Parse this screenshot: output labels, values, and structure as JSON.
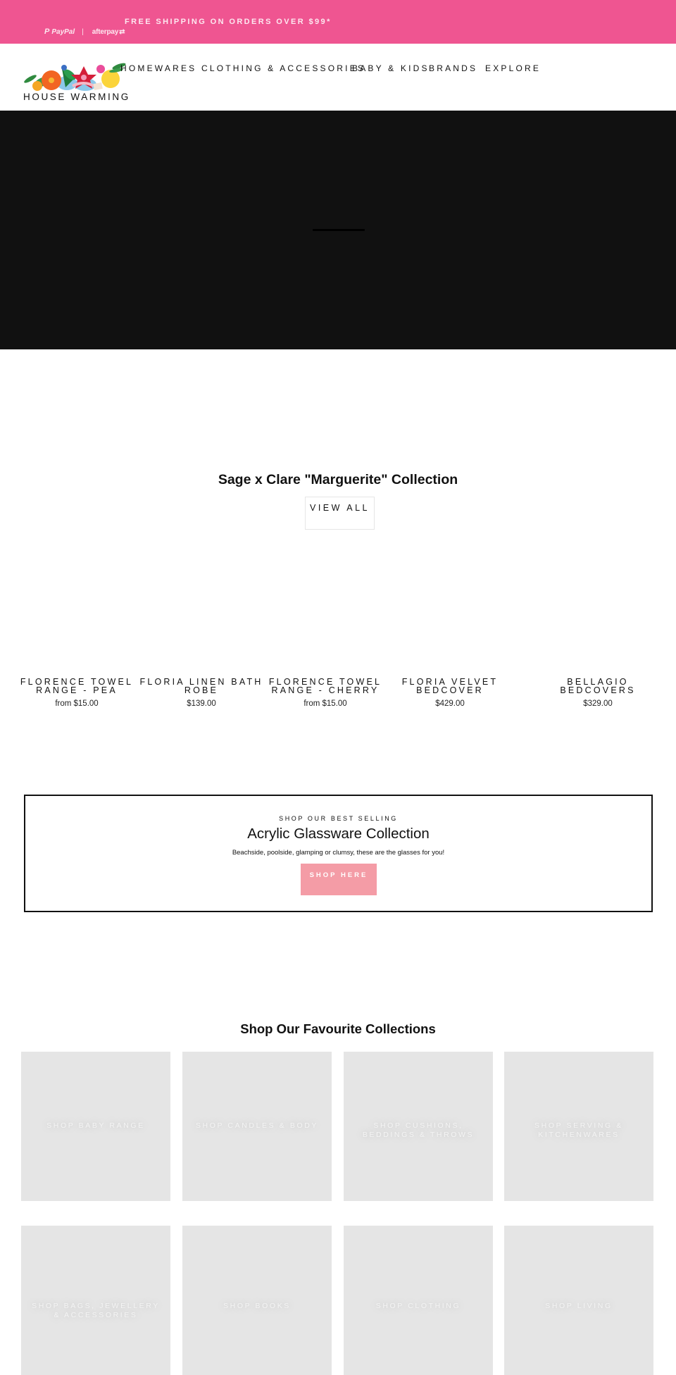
{
  "announcement": {
    "text": "FREE SHIPPING ON ORDERS OVER $99*",
    "payments": {
      "paypal_label": "PayPal",
      "separator": "|",
      "afterpay_label": "afterpay"
    }
  },
  "header": {
    "logo_text": "HOUSE WARMING",
    "nav": [
      {
        "label": "HOMEWARES"
      },
      {
        "label": "CLOTHING & ACCESSORIES"
      },
      {
        "label": "BABY & KIDS"
      },
      {
        "label": "BRANDS"
      },
      {
        "label": "EXPLORE"
      }
    ]
  },
  "featured": {
    "title": "Sage x Clare \"Marguerite\" Collection",
    "view_all_label": "VIEW ALL",
    "products": [
      {
        "name": "Florence Towel Range - Pea",
        "price": "from $15.00"
      },
      {
        "name": "Floria Linen Bath Robe",
        "price": "$139.00"
      },
      {
        "name": "Florence Towel Range - Cherry",
        "price": "from $15.00"
      },
      {
        "name": "Floria Velvet Bedcover",
        "price": "$429.00"
      },
      {
        "name": "Bellagio Bedcovers",
        "price": "$329.00"
      }
    ]
  },
  "promo": {
    "eyebrow": "SHOP OUR BEST SELLING",
    "title": "Acrylic Glassware Collection",
    "description": "Beachside, poolside, glamping or clumsy, these are the glasses for you!",
    "button_label": "SHOP HERE",
    "button_color": "#f49ca6"
  },
  "collections": {
    "title": "Shop Our Favourite Collections",
    "tiles": [
      {
        "label": "Shop Baby Range"
      },
      {
        "label": "Shop Candles & Body"
      },
      {
        "label": "Shop Cushions, Beddings & Throws"
      },
      {
        "label": "Shop Serving & Kitchenwares"
      },
      {
        "label": "Shop Bags, Jewellery & Accessories"
      },
      {
        "label": "Shop Books"
      },
      {
        "label": "Shop Clothing"
      },
      {
        "label": "Shop Living"
      }
    ]
  },
  "colors": {
    "announcement_bg": "#ef5591",
    "hero_bg": "#111111",
    "tile_bg": "#e5e5e5"
  }
}
